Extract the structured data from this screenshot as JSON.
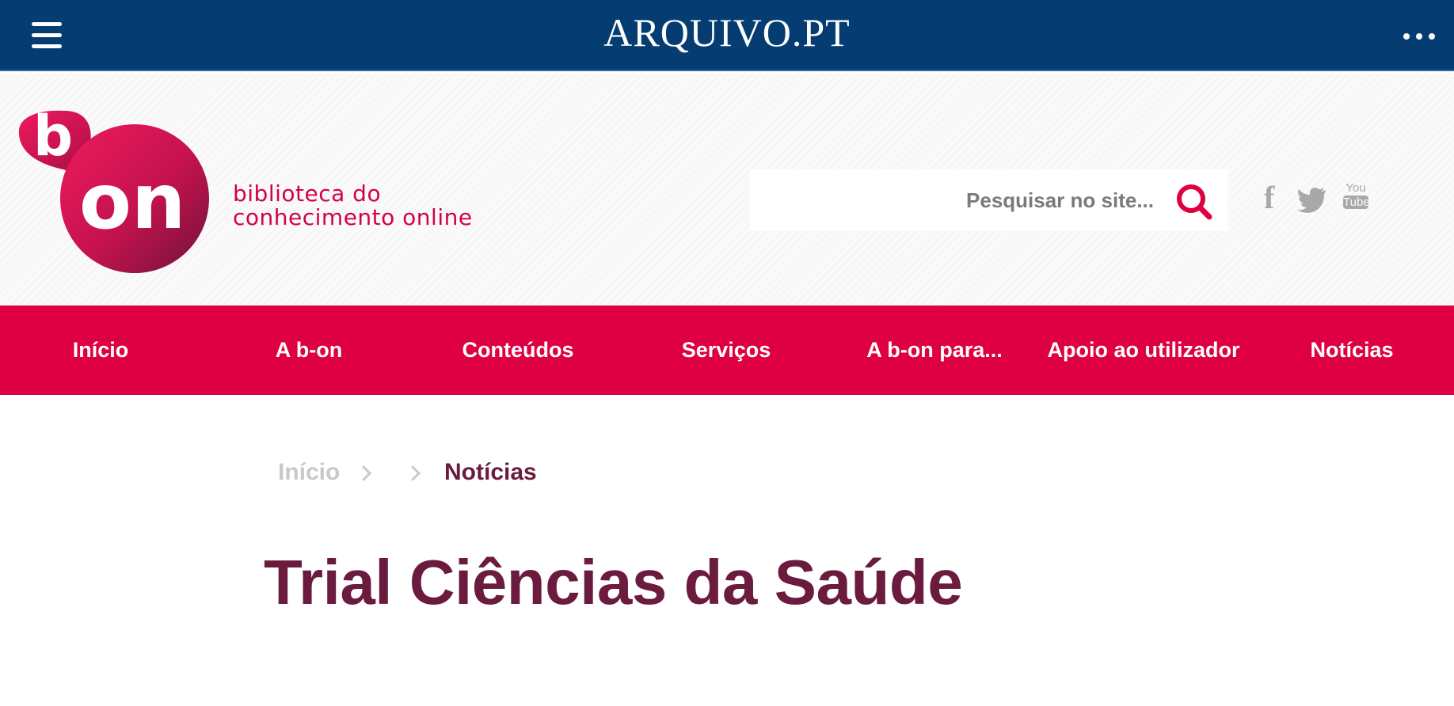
{
  "topbar": {
    "logo_text": "ARQUIVO.PT",
    "menu_icon": "hamburger-menu-icon",
    "more_icon": "more-dots-icon",
    "background_color": "#053d73"
  },
  "header": {
    "logo_letter_b": "b",
    "logo_word_on": "on",
    "tagline_line1": "biblioteca do",
    "tagline_line2": "conhecimento online",
    "search": {
      "placeholder": "Pesquisar no site...",
      "value": "",
      "icon": "search-icon"
    },
    "social": [
      {
        "name": "facebook",
        "glyph": "f",
        "icon": "facebook-icon"
      },
      {
        "name": "twitter",
        "icon": "twitter-icon"
      },
      {
        "name": "youtube",
        "line1": "You",
        "line2": "Tube",
        "icon": "youtube-icon"
      }
    ],
    "brand_color": "#d3004c"
  },
  "nav": {
    "items": [
      {
        "label": "Início"
      },
      {
        "label": "A b-on"
      },
      {
        "label": "Conteúdos"
      },
      {
        "label": "Serviços"
      },
      {
        "label": "A b-on para..."
      },
      {
        "label": "Apoio ao utilizador"
      },
      {
        "label": "Notícias"
      }
    ],
    "background_color": "#df0044"
  },
  "breadcrumb": {
    "home": "Início",
    "current": "Notícias",
    "separator_icon": "chevron-right-icon"
  },
  "page": {
    "title": "Trial Ciências da Saúde",
    "title_color": "#6b1b3d"
  }
}
